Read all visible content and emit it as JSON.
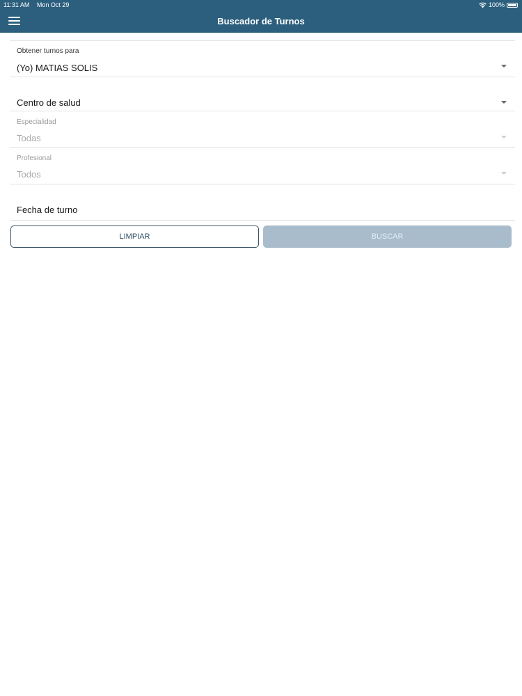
{
  "status_bar": {
    "time": "11:31 AM",
    "date": "Mon Oct 29",
    "battery": "100%"
  },
  "nav": {
    "title": "Buscador de Turnos",
    "menu_icon": "hamburger-menu-icon"
  },
  "form": {
    "patient": {
      "label": "Obtener turnos para",
      "value": "(Yo) MATIAS SOLIS"
    },
    "health_center": {
      "value": "Centro de salud"
    },
    "specialty": {
      "label": "Especialidad",
      "value": "Todas"
    },
    "professional": {
      "label": "Profesional",
      "value": "Todos"
    },
    "date": {
      "value": "Fecha de turno"
    }
  },
  "buttons": {
    "clear_label": "LIMPIAR",
    "search_label": "BUSCAR"
  },
  "colors": {
    "header": "#2c5f7e",
    "search_button_disabled": "#a8bccb"
  }
}
